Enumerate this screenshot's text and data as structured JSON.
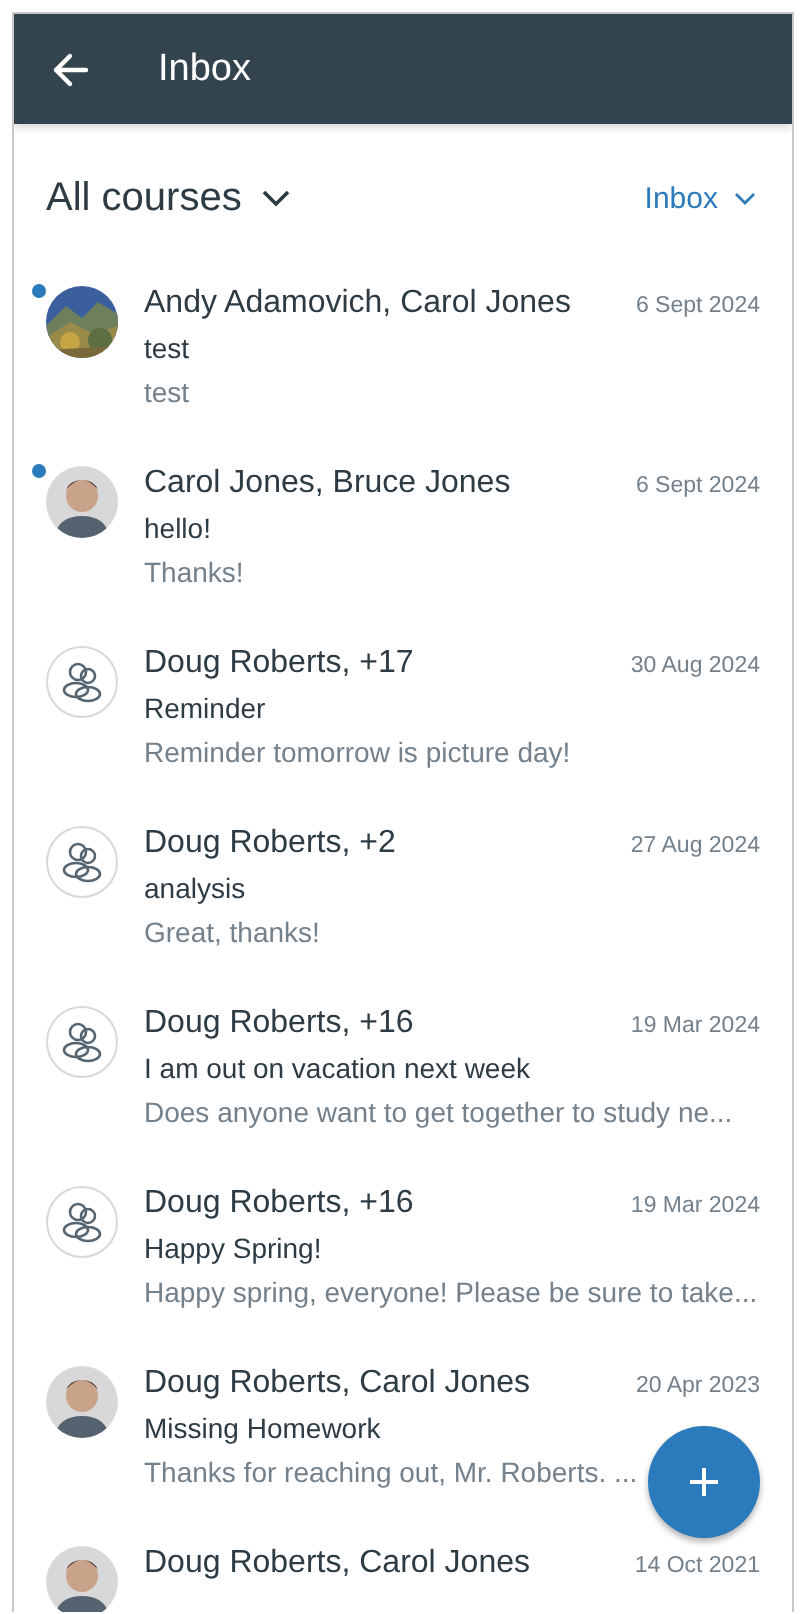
{
  "header": {
    "title": "Inbox"
  },
  "filters": {
    "course": "All courses",
    "scope": "Inbox"
  },
  "messages": [
    {
      "unread": true,
      "participants": "Andy Adamovich, Carol Jones",
      "date": "6 Sept 2024",
      "subject": "test",
      "preview": "test"
    },
    {
      "avatar": {
        "kind": "person"
      },
      "unread": true,
      "participants": "Carol Jones, Bruce Jones",
      "date": "6 Sept 2024",
      "subject": "hello!",
      "preview": "Thanks!"
    },
    {
      "avatar": {
        "kind": "group"
      },
      "unread": false,
      "participants": "Doug Roberts, +17",
      "date": "30 Aug 2024",
      "subject": "Reminder",
      "preview": "Reminder tomorrow is picture day!"
    },
    {
      "avatar": {
        "kind": "group"
      },
      "unread": false,
      "participants": "Doug Roberts, +2",
      "date": "27 Aug 2024",
      "subject": "analysis",
      "preview": "Great, thanks!"
    },
    {
      "avatar": {
        "kind": "group"
      },
      "unread": false,
      "participants": "Doug Roberts, +16",
      "date": "19 Mar 2024",
      "subject": "I am out on vacation next week",
      "preview": "Does anyone want to get together to study ne..."
    },
    {
      "avatar": {
        "kind": "group"
      },
      "unread": false,
      "participants": "Doug Roberts, +16",
      "date": "19 Mar 2024",
      "subject": "Happy Spring!",
      "preview": "Happy spring, everyone! Please be sure to take..."
    },
    {
      "avatar": {
        "kind": "person"
      },
      "unread": false,
      "participants": "Doug Roberts, Carol Jones",
      "date": "20 Apr 2023",
      "subject": "Missing Homework",
      "preview": "Thanks for reaching out, Mr. Roberts. ..."
    },
    {
      "avatar": {
        "kind": "person"
      },
      "unread": false,
      "participants": "Doug Roberts, Carol Jones",
      "date": "14 Oct 2021"
    }
  ]
}
